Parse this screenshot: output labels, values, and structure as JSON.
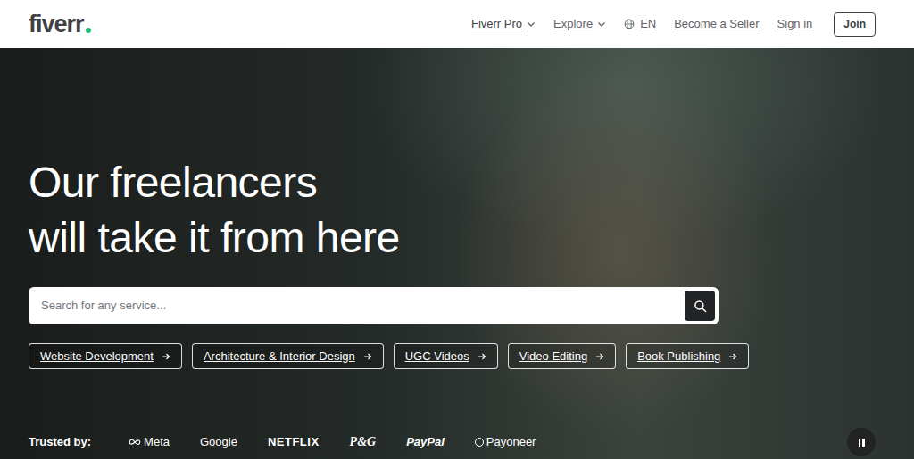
{
  "navbar": {
    "logo": "fiverr",
    "items": [
      {
        "label": "Fiverr Pro",
        "kind": "dropdown"
      },
      {
        "label": "Explore",
        "kind": "dropdown"
      },
      {
        "label": "EN",
        "kind": "language"
      },
      {
        "label": "Become a Seller",
        "kind": "link"
      },
      {
        "label": "Sign in",
        "kind": "link"
      }
    ],
    "join": "Join"
  },
  "hero": {
    "headline": [
      "Our freelancers",
      "will take it from here"
    ],
    "search": {
      "placeholder": "Search for any service..."
    },
    "chips": [
      "Website Development",
      "Architecture & Interior Design",
      "UGC Videos",
      "Video Editing",
      "Book Publishing"
    ]
  },
  "trusted": {
    "label": "Trusted by:",
    "brands": [
      {
        "name": "Meta",
        "kind": "infinity"
      },
      {
        "name": "Google",
        "kind": "plain"
      },
      {
        "name": "NETFLIX",
        "kind": "bold"
      },
      {
        "name": "P&G",
        "kind": "serif"
      },
      {
        "name": "PayPal",
        "kind": "italic"
      },
      {
        "name": "Payoneer",
        "kind": "ring"
      }
    ]
  },
  "video": {
    "playing": true
  }
}
